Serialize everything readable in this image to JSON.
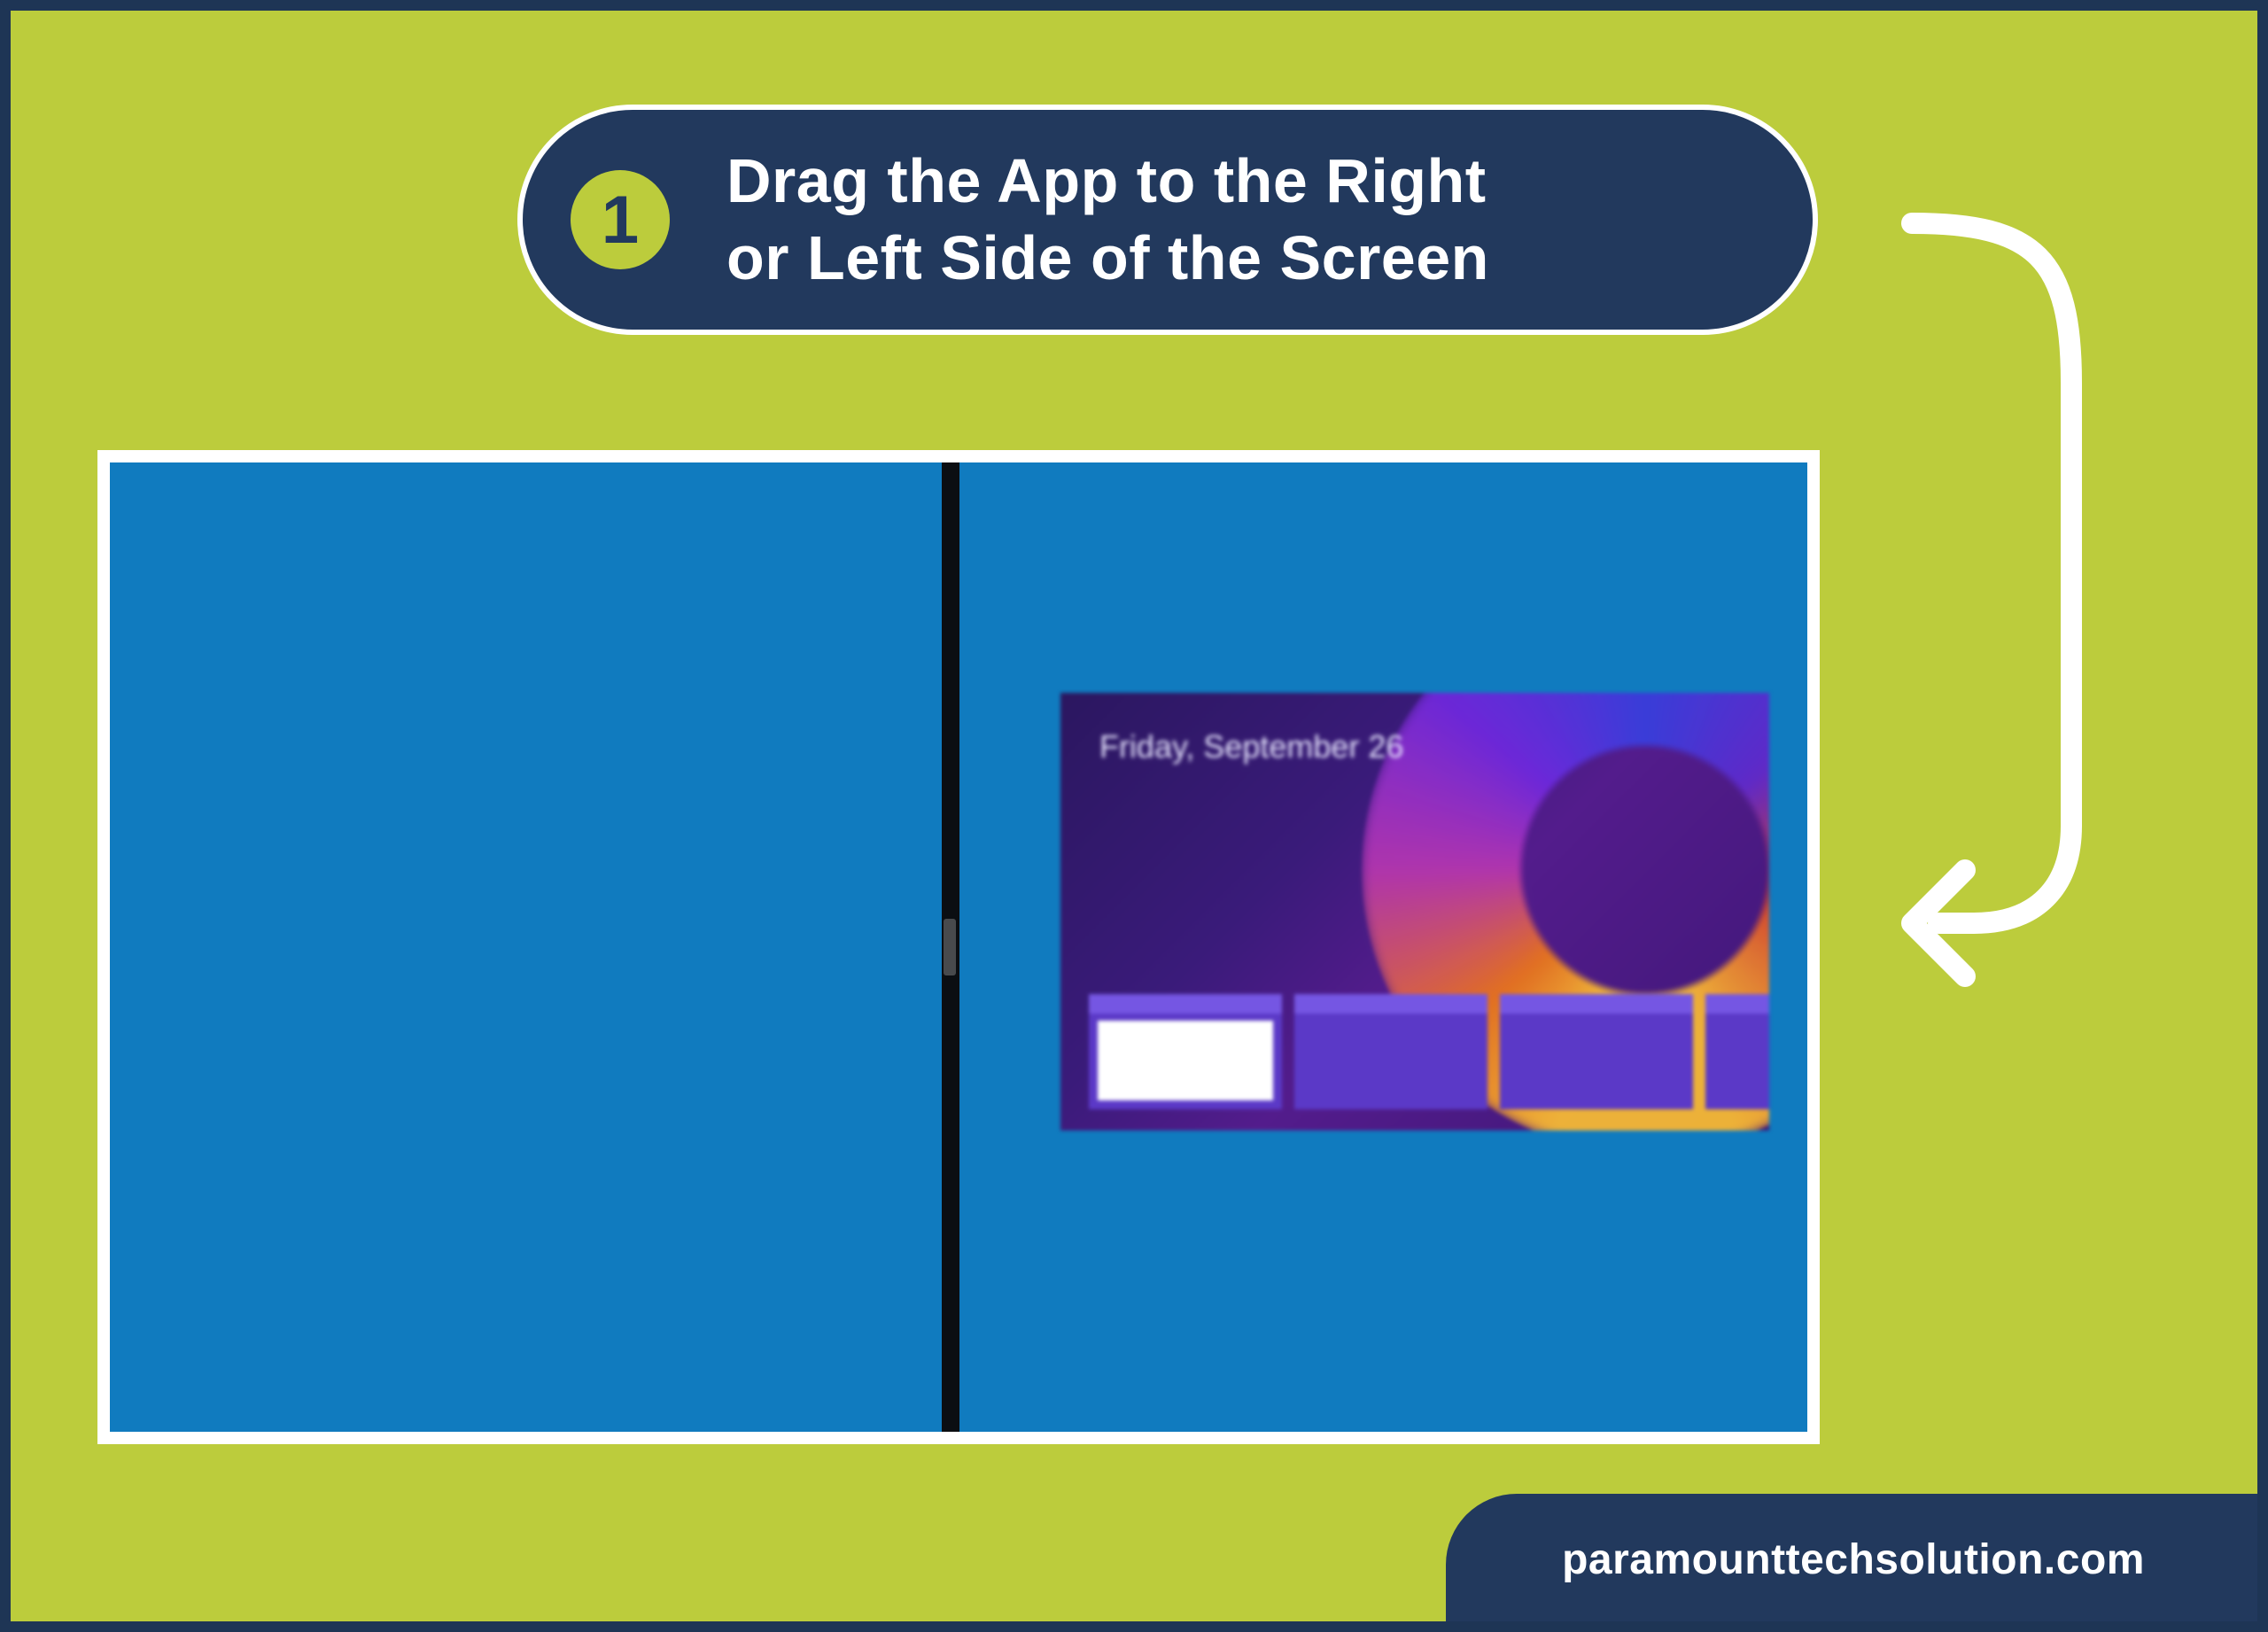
{
  "step": {
    "number": "1",
    "title": "Drag the App to the Right\nor Left Side of the Screen"
  },
  "screenshot": {
    "app_tile_date": "Friday, September 26"
  },
  "footer": {
    "text": "paramounttechsolution.com"
  },
  "colors": {
    "accent_bg": "#bccc3c",
    "dark": "#22395d",
    "screen_blue": "#107bbf"
  }
}
